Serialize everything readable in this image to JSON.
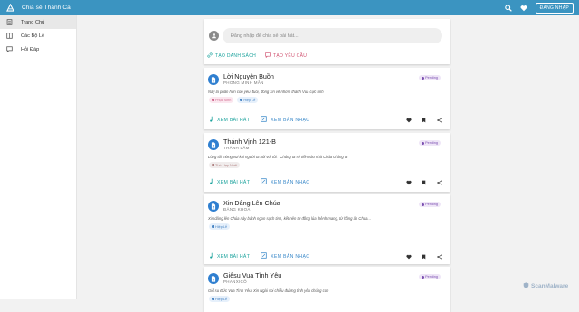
{
  "app": {
    "title": "Chia sẻ Thánh Ca",
    "login_label": "ĐĂNG NHẬP",
    "accent": "#3b94c1"
  },
  "sidebar": {
    "items": [
      {
        "label": "Trang Chủ",
        "icon": "home-icon",
        "active": true
      },
      {
        "label": "Các Bộ Lễ",
        "icon": "book-icon",
        "active": false
      },
      {
        "label": "Hỏi Đáp",
        "icon": "chat-icon",
        "active": false
      }
    ]
  },
  "composer": {
    "placeholder": "Đăng nhập để chia sẻ bài hát...",
    "list_label": "TẠO DANH SÁCH",
    "request_label": "TẠO YÊU CẦU"
  },
  "cards": [
    {
      "title": "Lời Nguyện Buồn",
      "author": "PHONG MINH MẪN",
      "status": "Pending",
      "desc": "Này là phần hơn con yêu đuối, đòng xin về nhờm thánh Vua cực tình",
      "tags": [
        {
          "label": "Phục Sinh",
          "color": "pink"
        },
        {
          "label": "Hiệp Lễ",
          "color": "blue"
        }
      ],
      "view_song": "XEM BÀI HÁT",
      "view_sheet": "XEM BẢN NHẠC"
    },
    {
      "title": "Thánh Vịnh 121-B",
      "author": "THÀNH LÂM",
      "status": "Pending",
      "desc": "Lòng tôi mừng vui khi người ta nói với tôi: \"Chúng ta sẽ tiến vào nhà Chúa chúng ta",
      "tags": [
        {
          "label": "Thờ Hạp Nhất",
          "color": "gray"
        }
      ],
      "view_song": "XEM BÀI HÁT",
      "view_sheet": "XEM BẢN NHẠC"
    },
    {
      "title": "Xin Dâng Lên Chúa",
      "author": "ĐĂNG KHOA",
      "status": "Pending",
      "desc": "Xin dâng lên Chúa này bánh ngon sạch tinh, kết nên từ đồng lúa thênh mang, từ hồng ân Chúa...",
      "tags": [
        {
          "label": "Hiệp Lễ",
          "color": "blue"
        }
      ],
      "view_song": "XEM BÀI HÁT",
      "view_sheet": "XEM BẢN NHẠC"
    },
    {
      "title": "Giêsu Vua Tình Yêu",
      "author": "PHANXICÔ",
      "status": "Pending",
      "desc": "Giê su Đức Vua Tình Yêu. Xin Ngài soi chiếu đường tình yêu chúng con",
      "tags": [
        {
          "label": "Hiệp Lễ",
          "color": "blue"
        }
      ],
      "view_song": "XEM BÀI HÁT",
      "view_sheet": "XEM BẢN NHẠC"
    }
  ],
  "watermark": "ScanMalware"
}
